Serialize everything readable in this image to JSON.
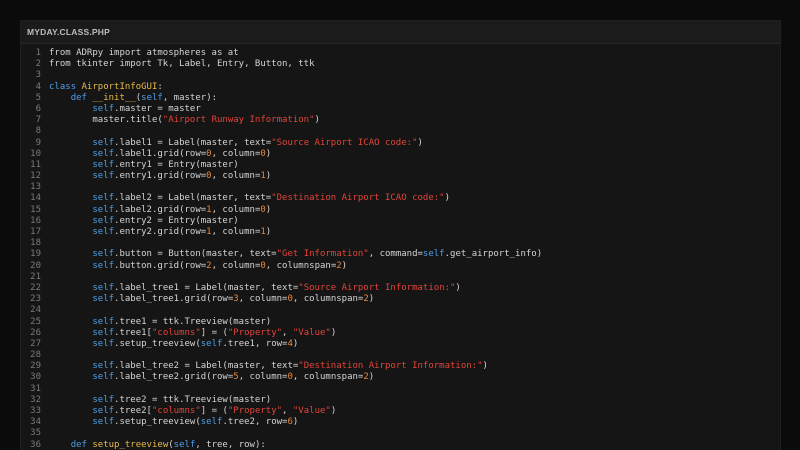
{
  "window": {
    "tab_title": "MYDAY.CLASS.PHP"
  },
  "colors": {
    "background": "#0b0b0b",
    "editor": "#151515",
    "keyword": "#4f9fe8",
    "class_name": "#e8b94c",
    "string": "#e2443a",
    "number": "#e8873a",
    "line_number": "#7a7a7a"
  },
  "code_lines": [
    {
      "n": "1",
      "tokens": [
        [
          "",
          "from ADRpy import atmospheres as at"
        ]
      ]
    },
    {
      "n": "2",
      "tokens": [
        [
          "",
          "from tkinter import Tk, Label, Entry, Button, ttk"
        ]
      ]
    },
    {
      "n": "3",
      "tokens": []
    },
    {
      "n": "4",
      "tokens": [
        [
          "kw",
          "class "
        ],
        [
          "cls",
          "AirportInfoGUI"
        ],
        [
          "",
          ":"
        ]
      ]
    },
    {
      "n": "5",
      "tokens": [
        [
          "",
          "    "
        ],
        [
          "kw",
          "def "
        ],
        [
          "fn",
          "__init__"
        ],
        [
          "",
          "("
        ],
        [
          "self",
          "self"
        ],
        [
          "",
          ", master):"
        ]
      ]
    },
    {
      "n": "6",
      "tokens": [
        [
          "",
          "        "
        ],
        [
          "self",
          "self"
        ],
        [
          "",
          ".master = master"
        ]
      ]
    },
    {
      "n": "7",
      "tokens": [
        [
          "",
          "        master.title("
        ],
        [
          "str",
          "\"Airport Runway Information\""
        ],
        [
          "",
          ")"
        ]
      ]
    },
    {
      "n": "8",
      "tokens": []
    },
    {
      "n": "9",
      "tokens": [
        [
          "",
          "        "
        ],
        [
          "self",
          "self"
        ],
        [
          "",
          ".label1 = Label(master, text="
        ],
        [
          "str",
          "\"Source Airport ICAO code:\""
        ],
        [
          "",
          ")"
        ]
      ]
    },
    {
      "n": "10",
      "tokens": [
        [
          "",
          "        "
        ],
        [
          "self",
          "self"
        ],
        [
          "",
          ".label1.grid(row="
        ],
        [
          "num",
          "0"
        ],
        [
          "",
          ", column="
        ],
        [
          "num",
          "0"
        ],
        [
          "",
          ")"
        ]
      ]
    },
    {
      "n": "11",
      "tokens": [
        [
          "",
          "        "
        ],
        [
          "self",
          "self"
        ],
        [
          "",
          ".entry1 = Entry(master)"
        ]
      ]
    },
    {
      "n": "12",
      "tokens": [
        [
          "",
          "        "
        ],
        [
          "self",
          "self"
        ],
        [
          "",
          ".entry1.grid(row="
        ],
        [
          "num",
          "0"
        ],
        [
          "",
          ", column="
        ],
        [
          "num",
          "1"
        ],
        [
          "",
          ")"
        ]
      ]
    },
    {
      "n": "13",
      "tokens": []
    },
    {
      "n": "14",
      "tokens": [
        [
          "",
          "        "
        ],
        [
          "self",
          "self"
        ],
        [
          "",
          ".label2 = Label(master, text="
        ],
        [
          "str",
          "\"Destination Airport ICAO code:\""
        ],
        [
          "",
          ")"
        ]
      ]
    },
    {
      "n": "15",
      "tokens": [
        [
          "",
          "        "
        ],
        [
          "self",
          "self"
        ],
        [
          "",
          ".label2.grid(row="
        ],
        [
          "num",
          "1"
        ],
        [
          "",
          ", column="
        ],
        [
          "num",
          "0"
        ],
        [
          "",
          ")"
        ]
      ]
    },
    {
      "n": "16",
      "tokens": [
        [
          "",
          "        "
        ],
        [
          "self",
          "self"
        ],
        [
          "",
          ".entry2 = Entry(master)"
        ]
      ]
    },
    {
      "n": "17",
      "tokens": [
        [
          "",
          "        "
        ],
        [
          "self",
          "self"
        ],
        [
          "",
          ".entry2.grid(row="
        ],
        [
          "num",
          "1"
        ],
        [
          "",
          ", column="
        ],
        [
          "num",
          "1"
        ],
        [
          "",
          ")"
        ]
      ]
    },
    {
      "n": "18",
      "tokens": []
    },
    {
      "n": "19",
      "tokens": [
        [
          "",
          "        "
        ],
        [
          "self",
          "self"
        ],
        [
          "",
          ".button = Button(master, text="
        ],
        [
          "str",
          "\"Get Information\""
        ],
        [
          "",
          ", command="
        ],
        [
          "self",
          "self"
        ],
        [
          "",
          ".get_airport_info)"
        ]
      ]
    },
    {
      "n": "20",
      "tokens": [
        [
          "",
          "        "
        ],
        [
          "self",
          "self"
        ],
        [
          "",
          ".button.grid(row="
        ],
        [
          "num",
          "2"
        ],
        [
          "",
          ", column="
        ],
        [
          "num",
          "0"
        ],
        [
          "",
          ", columnspan="
        ],
        [
          "num",
          "2"
        ],
        [
          "",
          ")"
        ]
      ]
    },
    {
      "n": "21",
      "tokens": []
    },
    {
      "n": "22",
      "tokens": [
        [
          "",
          "        "
        ],
        [
          "self",
          "self"
        ],
        [
          "",
          ".label_tree1 = Label(master, text="
        ],
        [
          "str",
          "\"Source Airport Information:\""
        ],
        [
          "",
          ")"
        ]
      ]
    },
    {
      "n": "23",
      "tokens": [
        [
          "",
          "        "
        ],
        [
          "self",
          "self"
        ],
        [
          "",
          ".label_tree1.grid(row="
        ],
        [
          "num",
          "3"
        ],
        [
          "",
          ", column="
        ],
        [
          "num",
          "0"
        ],
        [
          "",
          ", columnspan="
        ],
        [
          "num",
          "2"
        ],
        [
          "",
          ")"
        ]
      ]
    },
    {
      "n": "24",
      "tokens": []
    },
    {
      "n": "25",
      "tokens": [
        [
          "",
          "        "
        ],
        [
          "self",
          "self"
        ],
        [
          "",
          ".tree1 = ttk.Treeview(master)"
        ]
      ]
    },
    {
      "n": "26",
      "tokens": [
        [
          "",
          "        "
        ],
        [
          "self",
          "self"
        ],
        [
          "",
          ".tree1["
        ],
        [
          "str",
          "\"columns\""
        ],
        [
          "",
          "] = ("
        ],
        [
          "str",
          "\"Property\""
        ],
        [
          "",
          ", "
        ],
        [
          "str",
          "\"Value\""
        ],
        [
          "",
          ")"
        ]
      ]
    },
    {
      "n": "27",
      "tokens": [
        [
          "",
          "        "
        ],
        [
          "self",
          "self"
        ],
        [
          "",
          ".setup_treeview("
        ],
        [
          "self",
          "self"
        ],
        [
          "",
          ".tree1, row="
        ],
        [
          "num",
          "4"
        ],
        [
          "",
          ")"
        ]
      ]
    },
    {
      "n": "28",
      "tokens": []
    },
    {
      "n": "29",
      "tokens": [
        [
          "",
          "        "
        ],
        [
          "self",
          "self"
        ],
        [
          "",
          ".label_tree2 = Label(master, text="
        ],
        [
          "str",
          "\"Destination Airport Information:\""
        ],
        [
          "",
          ")"
        ]
      ]
    },
    {
      "n": "30",
      "tokens": [
        [
          "",
          "        "
        ],
        [
          "self",
          "self"
        ],
        [
          "",
          ".label_tree2.grid(row="
        ],
        [
          "num",
          "5"
        ],
        [
          "",
          ", column="
        ],
        [
          "num",
          "0"
        ],
        [
          "",
          ", columnspan="
        ],
        [
          "num",
          "2"
        ],
        [
          "",
          ")"
        ]
      ]
    },
    {
      "n": "31",
      "tokens": []
    },
    {
      "n": "32",
      "tokens": [
        [
          "",
          "        "
        ],
        [
          "self",
          "self"
        ],
        [
          "",
          ".tree2 = ttk.Treeview(master)"
        ]
      ]
    },
    {
      "n": "33",
      "tokens": [
        [
          "",
          "        "
        ],
        [
          "self",
          "self"
        ],
        [
          "",
          ".tree2["
        ],
        [
          "str",
          "\"columns\""
        ],
        [
          "",
          "] = ("
        ],
        [
          "str",
          "\"Property\""
        ],
        [
          "",
          ", "
        ],
        [
          "str",
          "\"Value\""
        ],
        [
          "",
          ")"
        ]
      ]
    },
    {
      "n": "34",
      "tokens": [
        [
          "",
          "        "
        ],
        [
          "self",
          "self"
        ],
        [
          "",
          ".setup_treeview("
        ],
        [
          "self",
          "self"
        ],
        [
          "",
          ".tree2, row="
        ],
        [
          "num",
          "6"
        ],
        [
          "",
          ")"
        ]
      ]
    },
    {
      "n": "35",
      "tokens": []
    },
    {
      "n": "36",
      "tokens": [
        [
          "",
          "    "
        ],
        [
          "kw",
          "def "
        ],
        [
          "fn",
          "setup_treeview"
        ],
        [
          "",
          "("
        ],
        [
          "self",
          "self"
        ],
        [
          "",
          ", tree, row):"
        ]
      ]
    }
  ]
}
